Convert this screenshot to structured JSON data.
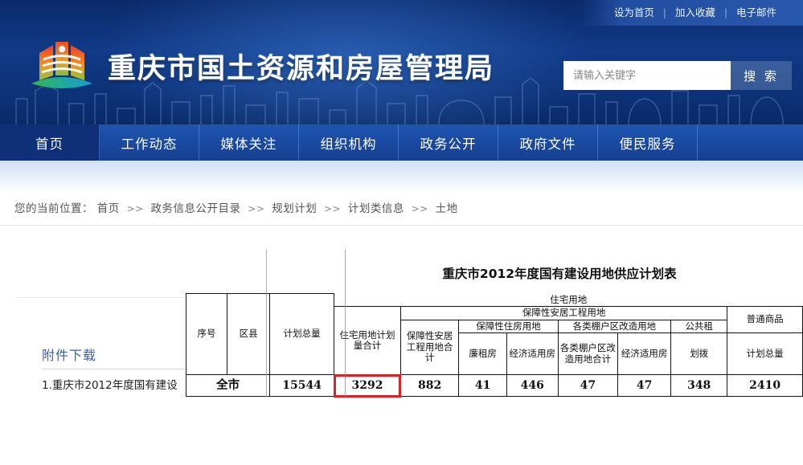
{
  "topbar": {
    "links": [
      "设为首页",
      "加入收藏",
      "电子邮件"
    ],
    "separator": "|"
  },
  "header": {
    "site_title": "重庆市国土资源和房屋管理局",
    "logo_icon": "chongqing-emblem-icon",
    "search": {
      "placeholder": "请输入关键字",
      "value": "",
      "button_label": "搜 索",
      "icon": "search-icon"
    }
  },
  "nav": {
    "items": [
      {
        "label": "首页",
        "active": true
      },
      {
        "label": "工作动态",
        "active": false
      },
      {
        "label": "媒体关注",
        "active": false
      },
      {
        "label": "组织机构",
        "active": false
      },
      {
        "label": "政务公开",
        "active": false
      },
      {
        "label": "政府文件",
        "active": false
      },
      {
        "label": "便民服务",
        "active": false
      }
    ]
  },
  "breadcrumb": {
    "prefix": "您的当前位置：",
    "arrow": ">>",
    "items": [
      "首页",
      "政务信息公开目录",
      "规划计划",
      "计划类信息",
      "土地"
    ]
  },
  "article": {
    "title": "重庆市2012年度国有建设用地供应计划表"
  },
  "attachment": {
    "heading": "附件下载",
    "items": [
      "1.重庆市2012年度国有建设"
    ]
  },
  "sheet": {
    "caption": "重庆市2012年度国有建设用地供应计划表",
    "headers": {
      "seq": "序号",
      "district": "区县",
      "plan_total": "计划总量",
      "residential_group": "住宅用地",
      "residential_total": "住宅用地计划量合计",
      "security_housing_group": "保障性安居工程用地",
      "security_housing_total": "保障性安居工程用地合计",
      "affordable_land": "保障性住房用地",
      "low_rent": "廉租房",
      "economic_housing": "经济适用房",
      "shanty_group": "各类棚户区改造用地",
      "shanty_total": "各类棚户区改造用地合计",
      "shanty_economic": "经济适用房",
      "public_rent": "公共租",
      "allocation": "划拨",
      "commercial_group": "普通商品",
      "commercial_total": "计划总量"
    },
    "rows": [
      {
        "label": "全市",
        "values": [
          "15544",
          "3292",
          "882",
          "41",
          "446",
          "47",
          "47",
          "348",
          "2410"
        ],
        "highlight_index": 1
      }
    ],
    "highlight_color": "#d6242a"
  }
}
